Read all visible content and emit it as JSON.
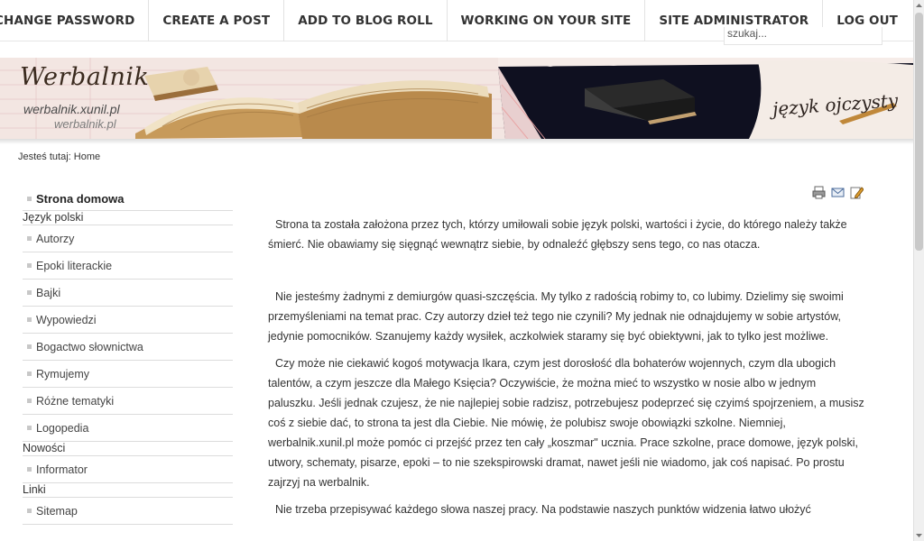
{
  "adminbar": {
    "items": [
      "CHANGE PASSWORD",
      "CREATE A POST",
      "ADD TO BLOG ROLL",
      "WORKING ON YOUR SITE",
      "SITE ADMINISTRATOR",
      "LOG OUT"
    ],
    "search_value": "szukaj..."
  },
  "banner": {
    "title": "Werbalnik",
    "url_primary": "werbalnik.xunil.pl",
    "url_secondary": "werbalnik.pl",
    "tagline": "język ojczysty"
  },
  "breadcrumb": "Jesteś tutaj: Home",
  "sidebar": {
    "home": "Strona domowa",
    "section1": "Język polski",
    "section1_items": [
      "Autorzy",
      "Epoki literackie",
      "Bajki",
      "Wypowiedzi",
      "Bogactwo słownictwa",
      "Rymujemy",
      "Różne tematyki",
      "Logopedia"
    ],
    "section2": "Nowości",
    "section2_items": [
      "Informator"
    ],
    "section3": "Linki",
    "section3_items": [
      "Sitemap"
    ]
  },
  "content": {
    "p1": "Strona ta została założona przez tych, którzy umiłowali sobie język polski, wartości i życie, do którego należy także śmierć. Nie obawiamy się sięgnąć wewnątrz siebie, by odnaleźć głębszy sens tego, co nas otacza.",
    "p2": "Nie jesteśmy żadnymi z demiurgów quasi-szczęścia. My tylko z radością robimy to, co lubimy. Dzielimy się swoimi przemyśleniami na temat prac. Czy autorzy dzieł też tego nie czynili? My jednak nie odnajdujemy w sobie artystów, jedynie pomocników. Szanujemy każdy wysiłek, aczkolwiek staramy się być obiektywni, jak to tylko jest możliwe.",
    "p3": "Czy może nie ciekawić kogoś motywacja Ikara, czym jest dorosłość dla bohaterów wojennych, czym dla ubogich talentów, a czym jeszcze dla Małego Księcia? Oczywiście, że można mieć to wszystko w nosie albo w jednym paluszku. Jeśli jednak czujesz, że nie najlepiej sobie radzisz, potrzebujesz podeprzeć się czyimś spojrzeniem, a musisz coś z siebie dać, to strona ta jest dla Ciebie. Nie mówię, że polubisz swoje obowiązki szkolne. Niemniej, werbalnik.xunil.pl może pomóc ci przejść przez ten cały „koszmar\" ucznia. Prace szkolne, prace domowe, język polski, utwory, schematy, pisarze, epoki – to nie szekspirowski dramat, nawet jeśli nie wiadomo, jak coś napisać. Po prostu zajrzyj na werbalnik.",
    "p4": "Nie trzeba przepisywać każdego słowa naszej pracy. Na podstawie naszych punktów widzenia łatwo ułożyć"
  },
  "colors": {
    "menu_bullet": "#c8c8c8",
    "divider": "#dcdcdc",
    "banner_dark": "#0f1020"
  },
  "icons": [
    "print-icon",
    "email-icon",
    "edit-icon"
  ]
}
